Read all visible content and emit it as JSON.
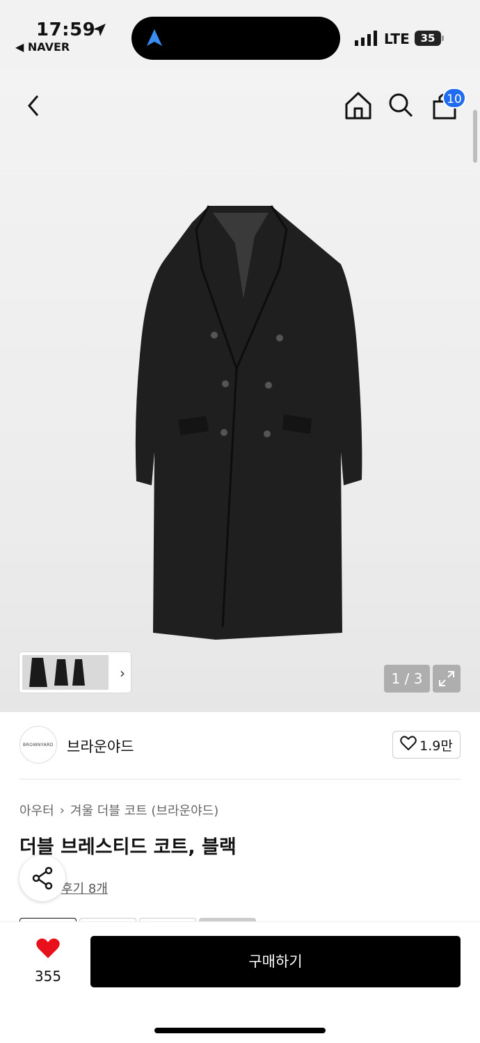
{
  "status_bar": {
    "time": "17:59",
    "back_app": "◀ NAVER",
    "network": "LTE",
    "battery": "35"
  },
  "header": {
    "cart_count": "10"
  },
  "gallery": {
    "counter": "1 / 3"
  },
  "brand": {
    "logo_text": "BROWNYARD",
    "name": "브라운야드",
    "likes": "1.9만"
  },
  "product": {
    "breadcrumb": [
      "아우터",
      "겨울 더블 코트 (브라운야드)"
    ],
    "title": "더블 브레스티드 코트, 블랙",
    "review_link": "후기 8개"
  },
  "bottom": {
    "wish_count": "355",
    "buy_label": "구매하기"
  },
  "colors": {
    "accent_blue": "#1f6cf0",
    "heart_red": "#e8101a",
    "buy_button": "#000000"
  }
}
